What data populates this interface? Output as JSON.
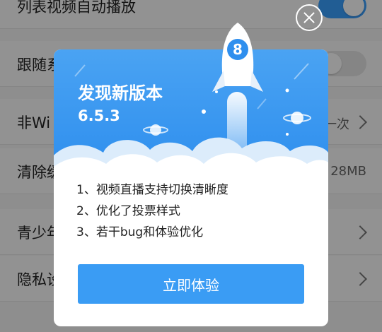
{
  "settings": {
    "rows": [
      {
        "label": "列表视频自动播放",
        "toggle": "on"
      },
      {
        "label": "跟随系统",
        "toggle": "off"
      },
      {
        "label": "非Wi",
        "value": "一次"
      },
      {
        "label": "清除缓",
        "value": "28MB"
      },
      {
        "label": "青少年"
      },
      {
        "label": "隐私设"
      }
    ]
  },
  "dialog": {
    "title": "发现新版本",
    "version": "6.5.3",
    "rocket_badge": "8",
    "notes": [
      "1、视频直播支持切换清晰度",
      "2、优化了投票样式",
      "3、若干bug和体验优化"
    ],
    "button_label": "立即体验"
  },
  "colors": {
    "accent": "#3a9cf4",
    "header_top": "#4aa3f3",
    "toggle_on": "#3aa0ff"
  },
  "icons": {
    "close": "close-icon",
    "chevron": "chevron-right-icon",
    "rocket": "rocket-icon",
    "planet": "planet-icon"
  }
}
